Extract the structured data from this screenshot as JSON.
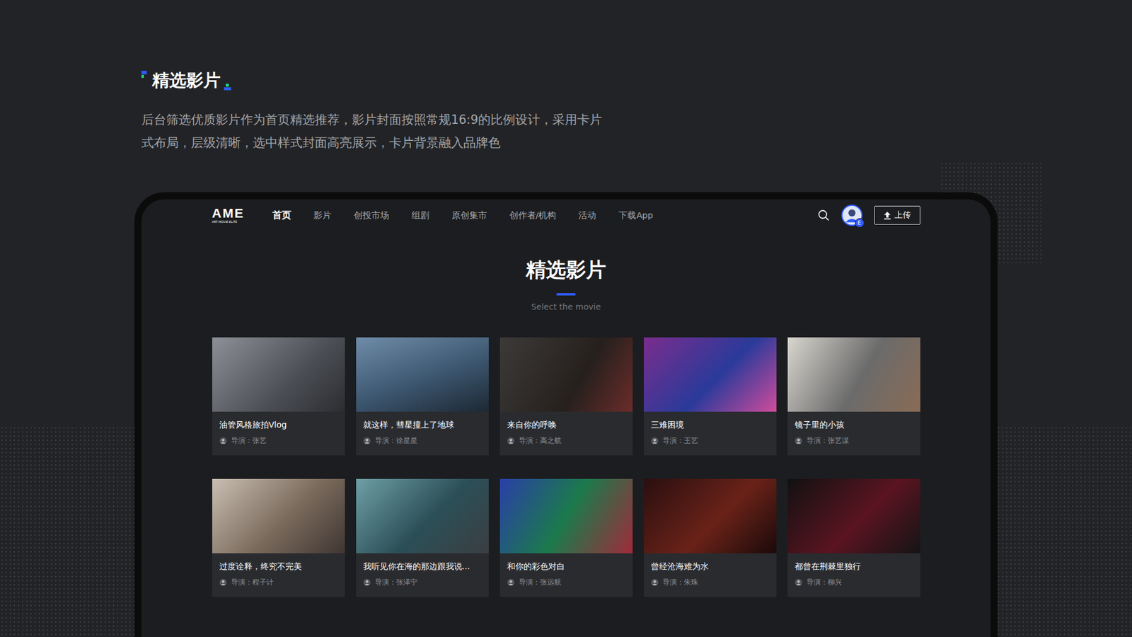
{
  "slide": {
    "title": "精选影片",
    "description": [
      "后台筛选优质影片作为首页精选推荐，影片封面按照常规16:9的比例设计，采用卡片",
      "式布局，层级清晰，选中样式封面高亮展示，卡片背景融入品牌色"
    ]
  },
  "nav": {
    "logo": "AME",
    "logo_subtitle": "ART·MOVIE·ELITE",
    "items": [
      {
        "label": "首页",
        "selected": true
      },
      {
        "label": "影片",
        "selected": false
      },
      {
        "label": "创投市场",
        "selected": false
      },
      {
        "label": "组剧",
        "selected": false
      },
      {
        "label": "原创集市",
        "selected": false
      },
      {
        "label": "创作者/机构",
        "selected": false
      },
      {
        "label": "活动",
        "selected": false
      },
      {
        "label": "下载App",
        "selected": false
      }
    ],
    "avatar_badge": "E",
    "upload_button": "上传"
  },
  "section": {
    "title": "精选影片",
    "subtitle": "Select the movie"
  },
  "movies": [
    {
      "title": "油管风格旅拍Vlog",
      "director": "导演：张艺"
    },
    {
      "title": "就这样，彗星撞上了地球",
      "director": "导演：徐星星"
    },
    {
      "title": "来自你的呼唤",
      "director": "导演：高之航"
    },
    {
      "title": "三难困境",
      "director": "导演：王艺"
    },
    {
      "title": "镜子里的小孩",
      "director": "导演：张艺谋"
    },
    {
      "title": "过度诠释，终究不完美",
      "director": "导演：程子计"
    },
    {
      "title": "我听见你在海的那边跟我说...",
      "director": "导演：张泽宁"
    },
    {
      "title": "和你的彩色对白",
      "director": "导演：张远航"
    },
    {
      "title": "曾经沧海难为水",
      "director": "导演：朱珠"
    },
    {
      "title": "都曾在荆棘里独行",
      "director": "导演：柳兴"
    }
  ]
}
